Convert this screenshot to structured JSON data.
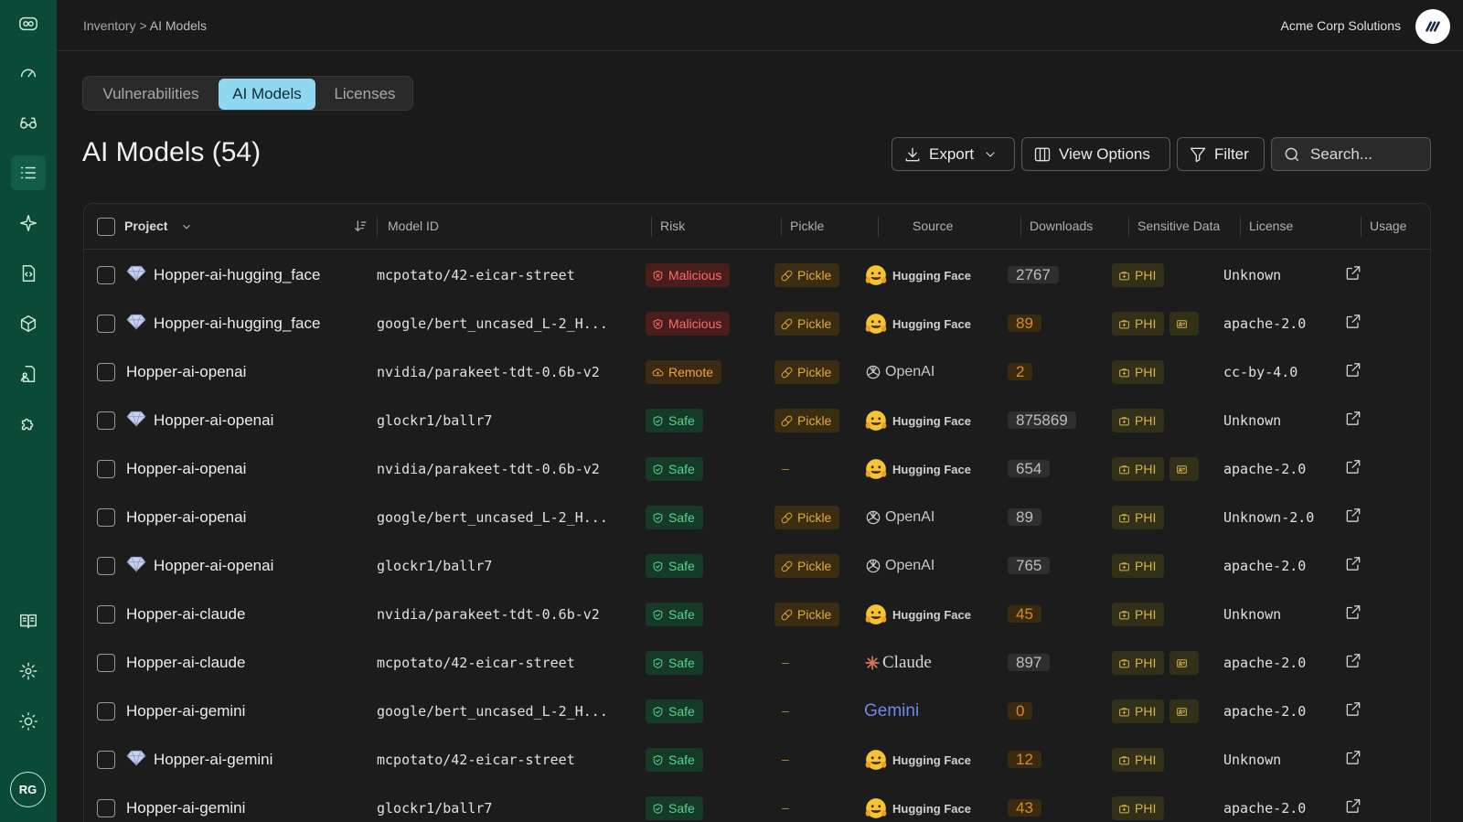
{
  "breadcrumb": {
    "parent": "Inventory >",
    "current": "AI Models"
  },
  "org": {
    "name": "Acme Corp Solutions"
  },
  "user": {
    "initials": "RG"
  },
  "tabs": [
    {
      "label": "Vulnerabilities",
      "active": false
    },
    {
      "label": "AI Models",
      "active": true
    },
    {
      "label": "Licenses",
      "active": false
    }
  ],
  "page": {
    "title": "AI Models (54)"
  },
  "toolbar": {
    "export_label": "Export",
    "view_options_label": "View Options",
    "filter_label": "Filter",
    "search_placeholder": "Search..."
  },
  "columns": [
    "Project",
    "Model ID",
    "Risk",
    "Pickle",
    "Source",
    "Downloads",
    "Sensitive Data",
    "License",
    "Usage"
  ],
  "rows": [
    {
      "gem": true,
      "project": "Hopper-ai-hugging_face",
      "model": "mcpotato/42-eicar-street",
      "risk": "Malicious",
      "pickle": "Pickle",
      "source": "Hugging Face",
      "downloads": "2767",
      "dl_style": "gray",
      "phi": "PHI",
      "extra": false,
      "license": "Unknown"
    },
    {
      "gem": true,
      "project": "Hopper-ai-hugging_face",
      "model": "google/bert_uncased_L-2_H...",
      "risk": "Malicious",
      "pickle": "Pickle",
      "source": "Hugging Face",
      "downloads": "89",
      "dl_style": "orange",
      "phi": "PHI",
      "extra": true,
      "license": "apache-2.0"
    },
    {
      "gem": false,
      "project": "Hopper-ai-openai",
      "model": "nvidia/parakeet-tdt-0.6b-v2",
      "risk": "Remote",
      "pickle": "Pickle",
      "source": "OpenAI",
      "downloads": "2",
      "dl_style": "orange",
      "phi": "PHI",
      "extra": false,
      "license": "cc-by-4.0"
    },
    {
      "gem": true,
      "project": "Hopper-ai-openai",
      "model": "glockr1/ballr7",
      "risk": "Safe",
      "pickle": "Pickle",
      "source": "Hugging Face",
      "downloads": "875869",
      "dl_style": "gray",
      "phi": "PHI",
      "extra": false,
      "license": "Unknown"
    },
    {
      "gem": false,
      "project": "Hopper-ai-openai",
      "model": "nvidia/parakeet-tdt-0.6b-v2",
      "risk": "Safe",
      "pickle": "–",
      "source": "Hugging Face",
      "downloads": "654",
      "dl_style": "gray",
      "phi": "PHI",
      "extra": true,
      "license": "apache-2.0"
    },
    {
      "gem": false,
      "project": "Hopper-ai-openai",
      "model": "google/bert_uncased_L-2_H...",
      "risk": "Safe",
      "pickle": "Pickle",
      "source": "OpenAI",
      "downloads": "89",
      "dl_style": "gray",
      "phi": "PHI",
      "extra": false,
      "license": "Unknown-2.0"
    },
    {
      "gem": true,
      "project": "Hopper-ai-openai",
      "model": "glockr1/ballr7",
      "risk": "Safe",
      "pickle": "Pickle",
      "source": "OpenAI",
      "downloads": "765",
      "dl_style": "gray",
      "phi": "PHI",
      "extra": false,
      "license": "apache-2.0"
    },
    {
      "gem": false,
      "project": "Hopper-ai-claude",
      "model": "nvidia/parakeet-tdt-0.6b-v2",
      "risk": "Safe",
      "pickle": "Pickle",
      "source": "Hugging Face",
      "downloads": "45",
      "dl_style": "orange",
      "phi": "PHI",
      "extra": false,
      "license": "Unknown"
    },
    {
      "gem": false,
      "project": "Hopper-ai-claude",
      "model": "mcpotato/42-eicar-street",
      "risk": "Safe",
      "pickle": "–",
      "source": "Claude",
      "downloads": "897",
      "dl_style": "gray",
      "phi": "PHI",
      "extra": true,
      "license": "apache-2.0"
    },
    {
      "gem": false,
      "project": "Hopper-ai-gemini",
      "model": "google/bert_uncased_L-2_H...",
      "risk": "Safe",
      "pickle": "–",
      "source": "Gemini",
      "downloads": "0",
      "dl_style": "orange",
      "phi": "PHI",
      "extra": true,
      "license": "apache-2.0"
    },
    {
      "gem": true,
      "project": "Hopper-ai-gemini",
      "model": "mcpotato/42-eicar-street",
      "risk": "Safe",
      "pickle": "–",
      "source": "Hugging Face",
      "downloads": "12",
      "dl_style": "orange",
      "phi": "PHI",
      "extra": false,
      "license": "Unknown"
    },
    {
      "gem": false,
      "project": "Hopper-ai-gemini",
      "model": "glockr1/ballr7",
      "risk": "Safe",
      "pickle": "–",
      "source": "Hugging Face",
      "downloads": "43",
      "dl_style": "orange",
      "phi": "PHI",
      "extra": false,
      "license": "apache-2.0"
    }
  ],
  "colors": {
    "sidebar": "#0b4a37",
    "active_tab": "#8fd8f0",
    "malicious": "#ff6b6b",
    "safe": "#56d38e",
    "pickle": "#e2a93f"
  }
}
